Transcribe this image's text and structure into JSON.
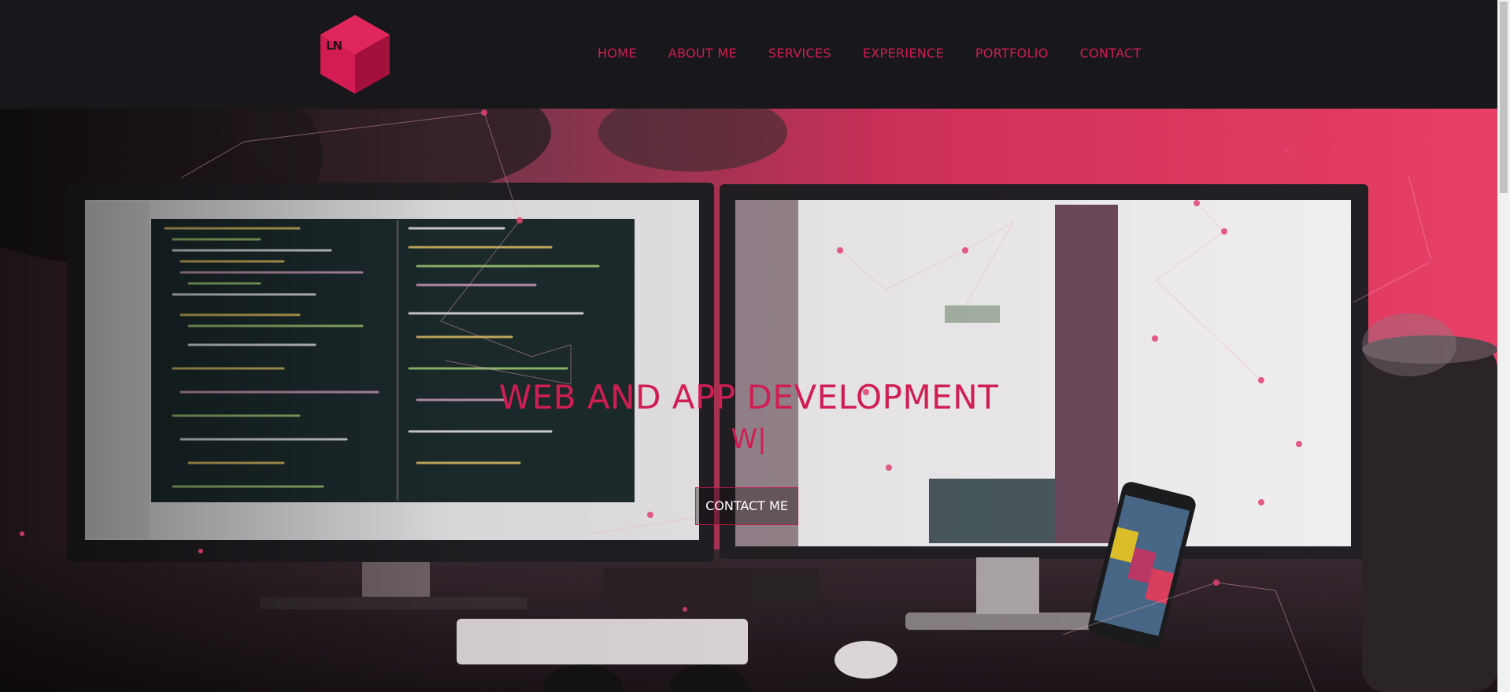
{
  "brand": {
    "logo_text": "LN"
  },
  "nav": {
    "items": [
      {
        "label": "HOME"
      },
      {
        "label": "ABOUT ME"
      },
      {
        "label": "SERVICES"
      },
      {
        "label": "EXPERIENCE"
      },
      {
        "label": "PORTFOLIO"
      },
      {
        "label": "CONTACT"
      }
    ]
  },
  "hero": {
    "title": "WEB AND APP DEVELOPMENT",
    "subtitle": "W|",
    "cta_label": "CONTACT ME",
    "image": "desk-with-monitors-photo"
  },
  "colors": {
    "accent": "#d01e53",
    "header_bg": "#18171c",
    "hero_wall": "#e23d63"
  }
}
